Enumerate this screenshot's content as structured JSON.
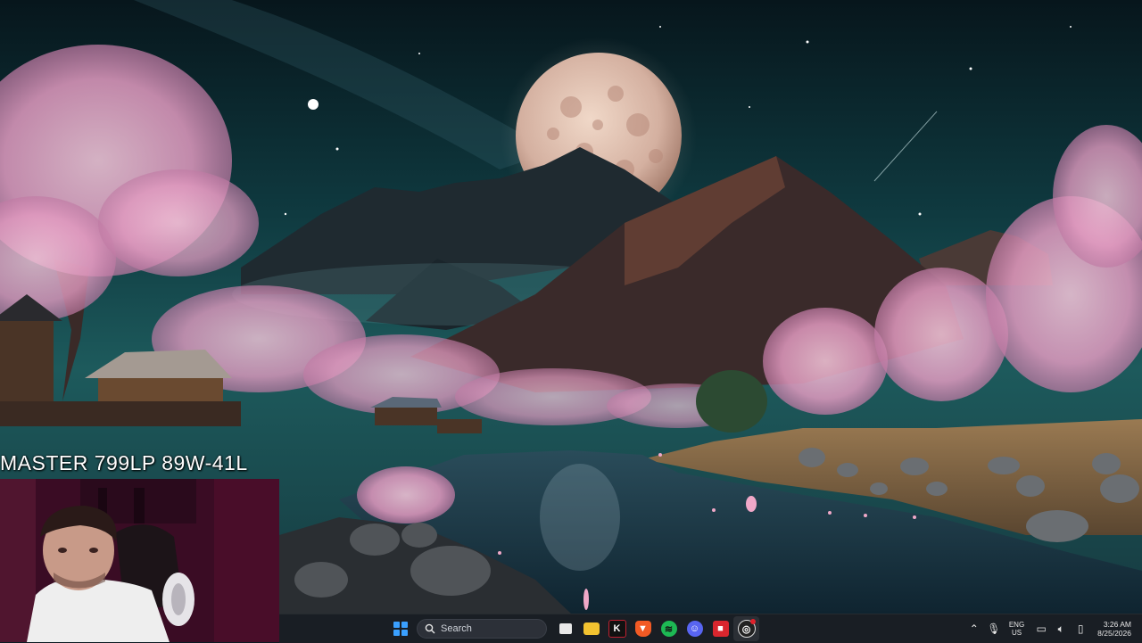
{
  "overlay": {
    "label": "MASTER 799LP 89W-41L"
  },
  "desktop": {
    "wallpaper_description_icon": "wallpaper-image"
  },
  "webcam": {
    "icon": "webcam-feed"
  },
  "taskbar": {
    "search_placeholder": "Search",
    "apps": [
      {
        "name": "task-view-icon"
      },
      {
        "name": "file-explorer-icon"
      },
      {
        "name": "kick-app-icon"
      },
      {
        "name": "brave-browser-icon"
      },
      {
        "name": "spotify-icon"
      },
      {
        "name": "discord-icon"
      },
      {
        "name": "red-app-icon"
      },
      {
        "name": "obs-studio-icon"
      }
    ],
    "tray": {
      "lang_top": "ENG",
      "lang_bottom": "US",
      "time": "3:26 AM",
      "date": "8/25/2026"
    }
  },
  "colors": {
    "taskbar_bg": "#1a1e24",
    "accent": "#3aa0ff"
  }
}
